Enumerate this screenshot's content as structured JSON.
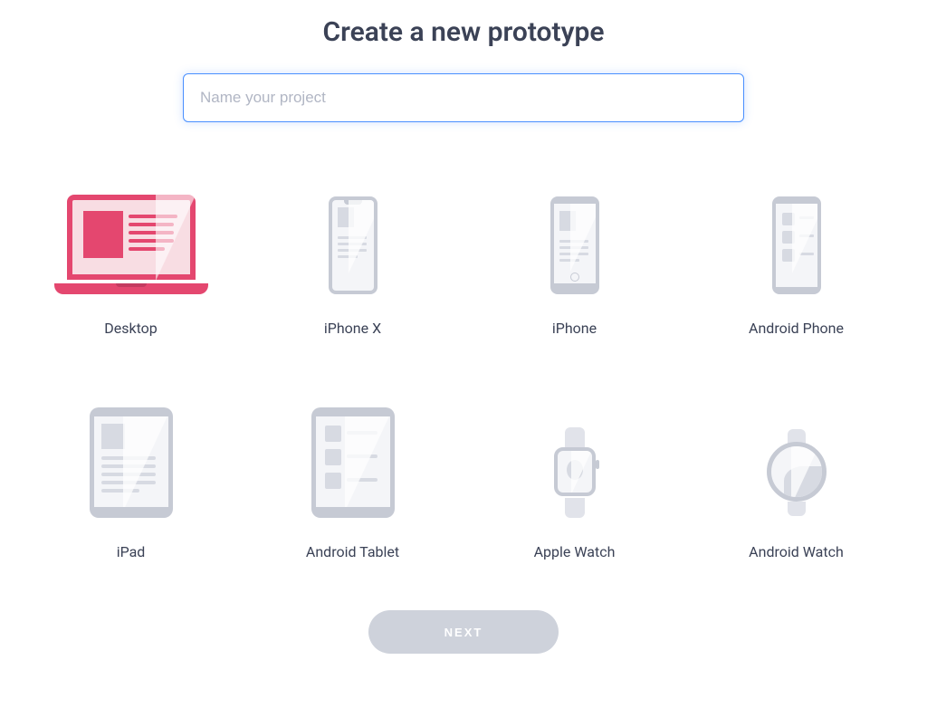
{
  "title": "Create a new prototype",
  "input": {
    "placeholder": "Name your project",
    "value": ""
  },
  "devices": [
    {
      "id": "desktop",
      "label": "Desktop",
      "selected": true
    },
    {
      "id": "iphone-x",
      "label": "iPhone X",
      "selected": false
    },
    {
      "id": "iphone",
      "label": "iPhone",
      "selected": false
    },
    {
      "id": "android-phone",
      "label": "Android Phone",
      "selected": false
    },
    {
      "id": "ipad",
      "label": "iPad",
      "selected": false
    },
    {
      "id": "android-tablet",
      "label": "Android Tablet",
      "selected": false
    },
    {
      "id": "apple-watch",
      "label": "Apple Watch",
      "selected": false
    },
    {
      "id": "android-watch",
      "label": "Android Watch",
      "selected": false
    }
  ],
  "next_button": {
    "label": "NEXT",
    "enabled": false
  },
  "colors": {
    "accent": "#e4476f",
    "focus": "#4a90ff",
    "muted": "#c6cad4",
    "text": "#3b4256"
  }
}
